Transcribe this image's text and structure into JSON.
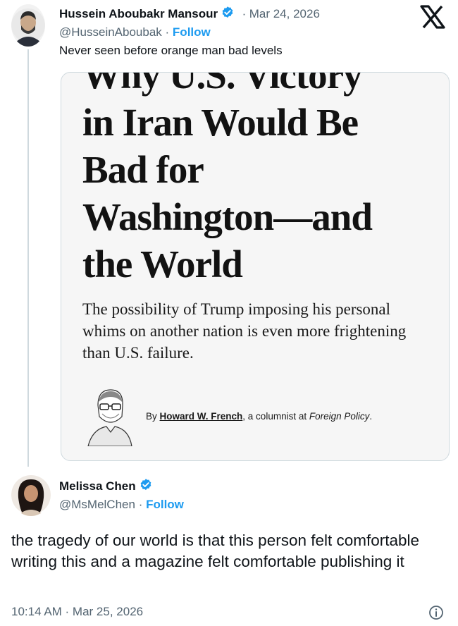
{
  "original_tweet": {
    "author_name": "Hussein Aboubakr Mansour",
    "date": "Mar 24, 2026",
    "handle": "@HusseinAboubak",
    "follow_label": "Follow",
    "text": "Never seen before orange man bad levels"
  },
  "article_card": {
    "headline_lines": [
      "Why U.S. Victory",
      "in Iran Would Be",
      "Bad for",
      "Washington—and",
      "the World"
    ],
    "subhead": "The possibility of Trump imposing his personal whims on another nation is even more frightening than U.S. failure.",
    "byline_prefix": "By",
    "byline_author": "Howard W. French",
    "byline_middle": ", a columnist at",
    "byline_publication": "Foreign Policy",
    "byline_suffix": "."
  },
  "reply_tweet": {
    "author_name": "Melissa Chen",
    "handle": "@MsMelChen",
    "follow_label": "Follow",
    "text": "the tragedy of our world is that this person felt comfortable writing this and a magazine felt comfortable publishing it",
    "timestamp": "10:14 AM · Mar 25, 2026"
  },
  "icons": {
    "platform_logo": "x-logo-icon",
    "verified": "verified-badge-icon",
    "info": "info-icon"
  },
  "colors": {
    "accent": "#1d9bf0",
    "secondary_text": "#536471",
    "border": "#cfd9de"
  }
}
